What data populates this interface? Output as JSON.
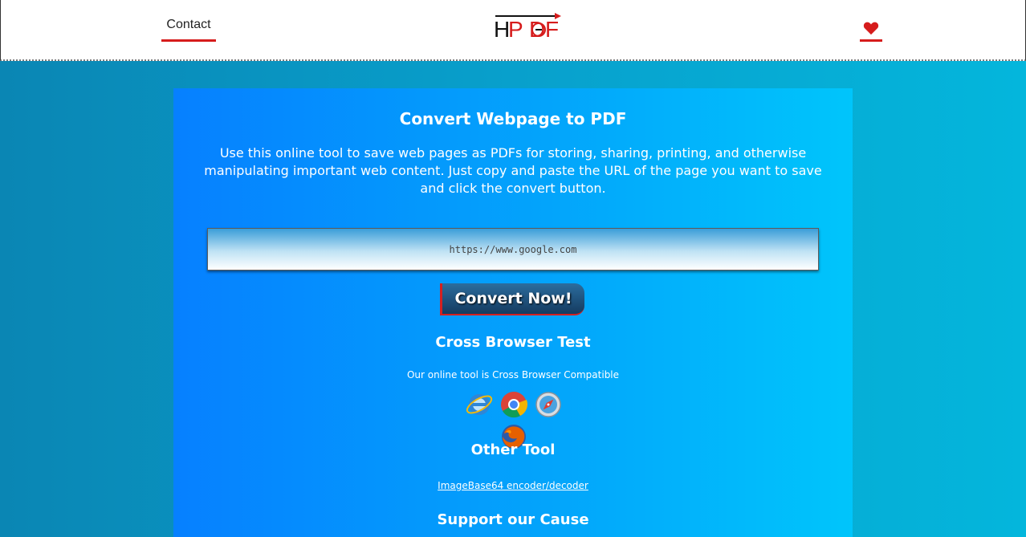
{
  "header": {
    "contact_label": "Contact",
    "logo_text": "HPDF",
    "favorite_icon": "heart-icon"
  },
  "main": {
    "title": "Convert Webpage to PDF",
    "intro": "Use this online tool to save web pages as PDFs for storing, sharing, printing, and otherwise manipulating important web content. Just copy and paste the URL of the page you want to save and click the convert button.",
    "url_value": "https://www.google.com",
    "convert_label": "Convert Now!",
    "cross_browser_heading": "Cross Browser Test",
    "cross_browser_text": "Our online tool is Cross Browser Compatible",
    "browsers": [
      "internet-explorer-icon",
      "chrome-icon",
      "safari-icon",
      "firefox-icon"
    ],
    "other_tool_heading": "Other Tool",
    "other_tool_link": "ImageBase64 encoder/decoder",
    "support_heading": "Support our Cause"
  },
  "colors": {
    "accent_red": "#d61c1c",
    "panel_blue": "#0680ff",
    "button_navy": "#153b60"
  }
}
